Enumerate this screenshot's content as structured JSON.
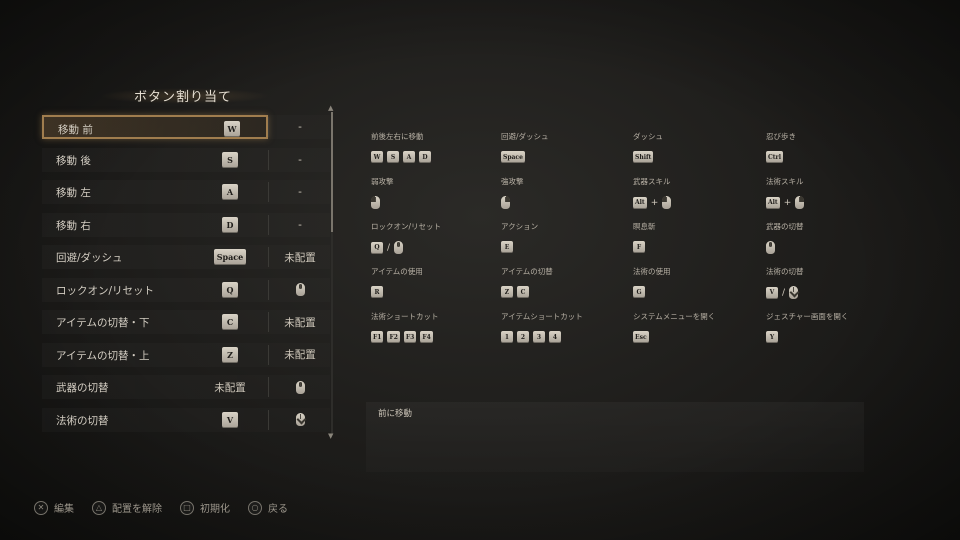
{
  "panel": {
    "title": "ボタン割り当て"
  },
  "bindings": [
    {
      "label": "移動 前",
      "key1": "W",
      "key1_type": "key",
      "key2": "-",
      "key2_type": "text",
      "selected": true
    },
    {
      "label": "移動 後",
      "key1": "S",
      "key1_type": "key",
      "key2": "-",
      "key2_type": "text"
    },
    {
      "label": "移動 左",
      "key1": "A",
      "key1_type": "key",
      "key2": "-",
      "key2_type": "text"
    },
    {
      "label": "移動 右",
      "key1": "D",
      "key1_type": "key",
      "key2": "-",
      "key2_type": "text"
    },
    {
      "label": "回避/ダッシュ",
      "key1": "Space",
      "key1_type": "key",
      "key2": "未配置",
      "key2_type": "text"
    },
    {
      "label": "ロックオン/リセット",
      "key1": "Q",
      "key1_type": "key",
      "key2": "mouse-wheel-icon",
      "key2_type": "mouse-wheel"
    },
    {
      "label": "アイテムの切替・下",
      "key1": "C",
      "key1_type": "key",
      "key2": "未配置",
      "key2_type": "text"
    },
    {
      "label": "アイテムの切替・上",
      "key1": "Z",
      "key1_type": "key",
      "key2": "未配置",
      "key2_type": "text"
    },
    {
      "label": "武器の切替",
      "key1": "未配置",
      "key1_type": "text",
      "key2": "mouse-wheel-up-icon",
      "key2_type": "mouse-wheel"
    },
    {
      "label": "法術の切替",
      "key1": "V",
      "key1_type": "key",
      "key2": "mouse-wheel-down-icon",
      "key2_type": "mouse-wheeldn"
    }
  ],
  "overview": [
    {
      "label": "前後左右に移動",
      "keys": [
        "W",
        "S",
        "A",
        "D"
      ]
    },
    {
      "label": "回避/ダッシュ",
      "keys": [
        "Space"
      ]
    },
    {
      "label": "ダッシュ",
      "keys": [
        "Shift"
      ]
    },
    {
      "label": "忍び歩き",
      "keys": [
        "Ctrl"
      ]
    },
    {
      "label": "弱攻撃",
      "mouse": "left"
    },
    {
      "label": "強攻撃",
      "mouse": "right"
    },
    {
      "label": "武器スキル",
      "keys": [
        "Alt"
      ],
      "plus": "+",
      "mouse": "left"
    },
    {
      "label": "法術スキル",
      "keys": [
        "Alt"
      ],
      "plus": "+",
      "mouse": "right"
    },
    {
      "label": "ロックオン/リセット",
      "keys": [
        "Q"
      ],
      "slash": "/",
      "mouse": "wheel"
    },
    {
      "label": "アクション",
      "keys": [
        "E"
      ]
    },
    {
      "label": "瞑息斬",
      "keys": [
        "F"
      ]
    },
    {
      "label": "武器の切替",
      "mouse": "wheel"
    },
    {
      "label": "アイテムの使用",
      "keys": [
        "R"
      ]
    },
    {
      "label": "アイテムの切替",
      "keys": [
        "Z",
        "C"
      ]
    },
    {
      "label": "法術の使用",
      "keys": [
        "G"
      ]
    },
    {
      "label": "法術の切替",
      "keys": [
        "V"
      ],
      "slash": "/",
      "mouse": "wheeldn"
    },
    {
      "label": "法術ショートカット",
      "keys": [
        "F1",
        "F2",
        "F3",
        "F4"
      ]
    },
    {
      "label": "アイテムショートカット",
      "keys": [
        "1",
        "2",
        "3",
        "4"
      ]
    },
    {
      "label": "システムメニューを開く",
      "keys": [
        "Esc"
      ]
    },
    {
      "label": "ジェスチャー画面を開く",
      "keys": [
        "Y"
      ]
    }
  ],
  "description": "前に移動",
  "footer": [
    {
      "icon": "cross-button-icon",
      "glyph": "✕",
      "label": "編集"
    },
    {
      "icon": "triangle-button-icon",
      "glyph": "△",
      "label": "配置を解除"
    },
    {
      "icon": "square-button-icon",
      "glyph": "□",
      "label": "初期化"
    },
    {
      "icon": "circle-button-icon",
      "glyph": "○",
      "label": "戻る"
    }
  ],
  "colors": {
    "accent": "#a07d4e",
    "background": "#1f1e1c",
    "text": "#d4cec3"
  }
}
